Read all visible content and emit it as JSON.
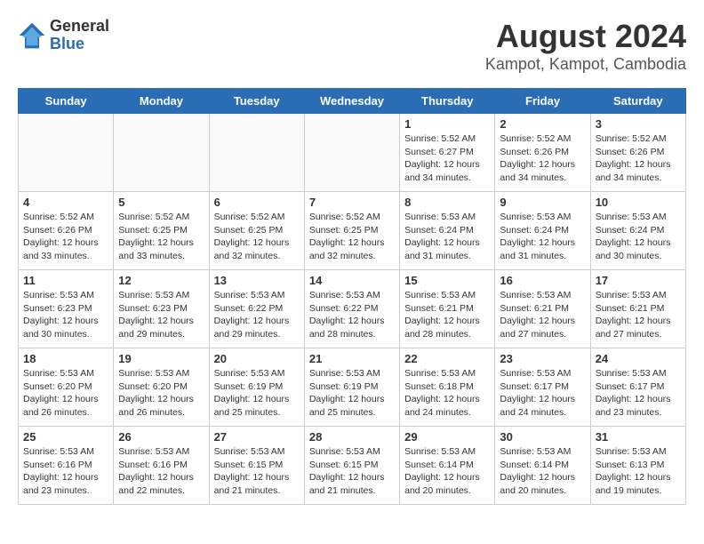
{
  "logo": {
    "general": "General",
    "blue": "Blue"
  },
  "title": "August 2024",
  "subtitle": "Kampot, Kampot, Cambodia",
  "weekdays": [
    "Sunday",
    "Monday",
    "Tuesday",
    "Wednesday",
    "Thursday",
    "Friday",
    "Saturday"
  ],
  "weeks": [
    [
      {
        "day": "",
        "info": ""
      },
      {
        "day": "",
        "info": ""
      },
      {
        "day": "",
        "info": ""
      },
      {
        "day": "",
        "info": ""
      },
      {
        "day": "1",
        "info": "Sunrise: 5:52 AM\nSunset: 6:27 PM\nDaylight: 12 hours\nand 34 minutes."
      },
      {
        "day": "2",
        "info": "Sunrise: 5:52 AM\nSunset: 6:26 PM\nDaylight: 12 hours\nand 34 minutes."
      },
      {
        "day": "3",
        "info": "Sunrise: 5:52 AM\nSunset: 6:26 PM\nDaylight: 12 hours\nand 34 minutes."
      }
    ],
    [
      {
        "day": "4",
        "info": "Sunrise: 5:52 AM\nSunset: 6:26 PM\nDaylight: 12 hours\nand 33 minutes."
      },
      {
        "day": "5",
        "info": "Sunrise: 5:52 AM\nSunset: 6:25 PM\nDaylight: 12 hours\nand 33 minutes."
      },
      {
        "day": "6",
        "info": "Sunrise: 5:52 AM\nSunset: 6:25 PM\nDaylight: 12 hours\nand 32 minutes."
      },
      {
        "day": "7",
        "info": "Sunrise: 5:52 AM\nSunset: 6:25 PM\nDaylight: 12 hours\nand 32 minutes."
      },
      {
        "day": "8",
        "info": "Sunrise: 5:53 AM\nSunset: 6:24 PM\nDaylight: 12 hours\nand 31 minutes."
      },
      {
        "day": "9",
        "info": "Sunrise: 5:53 AM\nSunset: 6:24 PM\nDaylight: 12 hours\nand 31 minutes."
      },
      {
        "day": "10",
        "info": "Sunrise: 5:53 AM\nSunset: 6:24 PM\nDaylight: 12 hours\nand 30 minutes."
      }
    ],
    [
      {
        "day": "11",
        "info": "Sunrise: 5:53 AM\nSunset: 6:23 PM\nDaylight: 12 hours\nand 30 minutes."
      },
      {
        "day": "12",
        "info": "Sunrise: 5:53 AM\nSunset: 6:23 PM\nDaylight: 12 hours\nand 29 minutes."
      },
      {
        "day": "13",
        "info": "Sunrise: 5:53 AM\nSunset: 6:22 PM\nDaylight: 12 hours\nand 29 minutes."
      },
      {
        "day": "14",
        "info": "Sunrise: 5:53 AM\nSunset: 6:22 PM\nDaylight: 12 hours\nand 28 minutes."
      },
      {
        "day": "15",
        "info": "Sunrise: 5:53 AM\nSunset: 6:21 PM\nDaylight: 12 hours\nand 28 minutes."
      },
      {
        "day": "16",
        "info": "Sunrise: 5:53 AM\nSunset: 6:21 PM\nDaylight: 12 hours\nand 27 minutes."
      },
      {
        "day": "17",
        "info": "Sunrise: 5:53 AM\nSunset: 6:21 PM\nDaylight: 12 hours\nand 27 minutes."
      }
    ],
    [
      {
        "day": "18",
        "info": "Sunrise: 5:53 AM\nSunset: 6:20 PM\nDaylight: 12 hours\nand 26 minutes."
      },
      {
        "day": "19",
        "info": "Sunrise: 5:53 AM\nSunset: 6:20 PM\nDaylight: 12 hours\nand 26 minutes."
      },
      {
        "day": "20",
        "info": "Sunrise: 5:53 AM\nSunset: 6:19 PM\nDaylight: 12 hours\nand 25 minutes."
      },
      {
        "day": "21",
        "info": "Sunrise: 5:53 AM\nSunset: 6:19 PM\nDaylight: 12 hours\nand 25 minutes."
      },
      {
        "day": "22",
        "info": "Sunrise: 5:53 AM\nSunset: 6:18 PM\nDaylight: 12 hours\nand 24 minutes."
      },
      {
        "day": "23",
        "info": "Sunrise: 5:53 AM\nSunset: 6:17 PM\nDaylight: 12 hours\nand 24 minutes."
      },
      {
        "day": "24",
        "info": "Sunrise: 5:53 AM\nSunset: 6:17 PM\nDaylight: 12 hours\nand 23 minutes."
      }
    ],
    [
      {
        "day": "25",
        "info": "Sunrise: 5:53 AM\nSunset: 6:16 PM\nDaylight: 12 hours\nand 23 minutes."
      },
      {
        "day": "26",
        "info": "Sunrise: 5:53 AM\nSunset: 6:16 PM\nDaylight: 12 hours\nand 22 minutes."
      },
      {
        "day": "27",
        "info": "Sunrise: 5:53 AM\nSunset: 6:15 PM\nDaylight: 12 hours\nand 21 minutes."
      },
      {
        "day": "28",
        "info": "Sunrise: 5:53 AM\nSunset: 6:15 PM\nDaylight: 12 hours\nand 21 minutes."
      },
      {
        "day": "29",
        "info": "Sunrise: 5:53 AM\nSunset: 6:14 PM\nDaylight: 12 hours\nand 20 minutes."
      },
      {
        "day": "30",
        "info": "Sunrise: 5:53 AM\nSunset: 6:14 PM\nDaylight: 12 hours\nand 20 minutes."
      },
      {
        "day": "31",
        "info": "Sunrise: 5:53 AM\nSunset: 6:13 PM\nDaylight: 12 hours\nand 19 minutes."
      }
    ]
  ]
}
